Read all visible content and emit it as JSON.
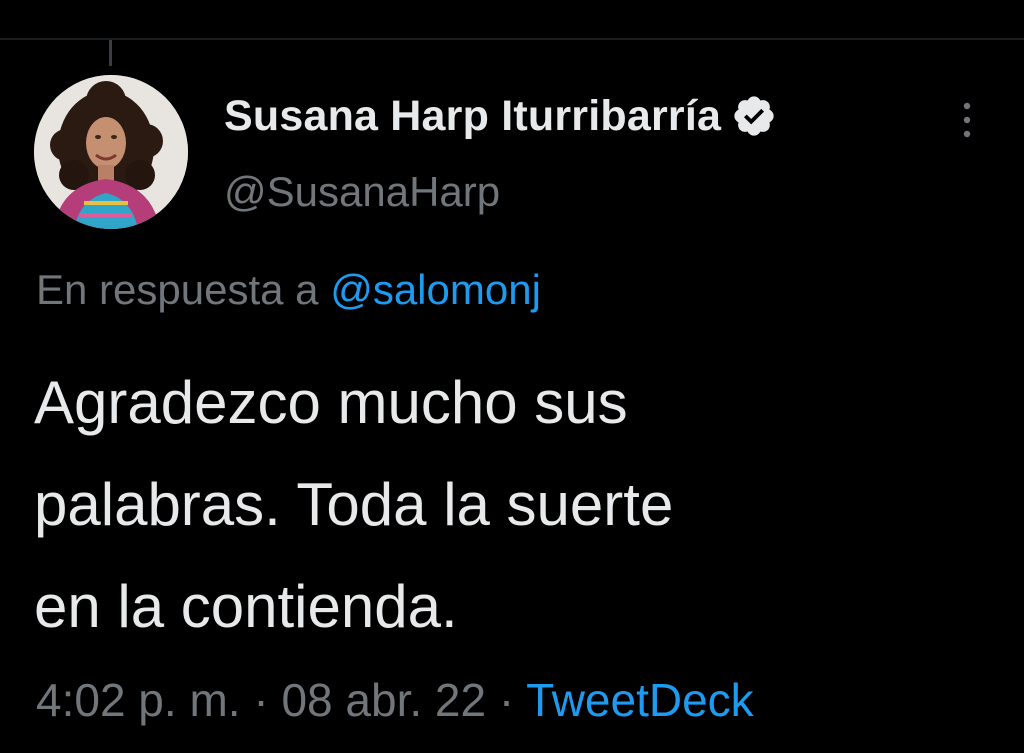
{
  "tweet": {
    "author": {
      "display_name": "Susana Harp Iturribarría",
      "handle": "@SusanaHarp",
      "verified": true,
      "avatar_icon": "profile-photo"
    },
    "reply": {
      "prefix": "En respuesta a",
      "mention": "@salomonj"
    },
    "text_lines": [
      "Agradezco mucho sus",
      "palabras. Toda la suerte",
      "en la contienda."
    ],
    "meta": {
      "time": "4:02 p. m.",
      "separator": "·",
      "date": "08 abr. 22",
      "source": "TweetDeck"
    }
  },
  "colors": {
    "background": "#000000",
    "primary_text": "#e7e9ea",
    "secondary_text": "#71767b",
    "accent": "#1d9bf0"
  },
  "icons": {
    "verified": "verified-badge-icon",
    "more": "more-vertical-icon"
  }
}
